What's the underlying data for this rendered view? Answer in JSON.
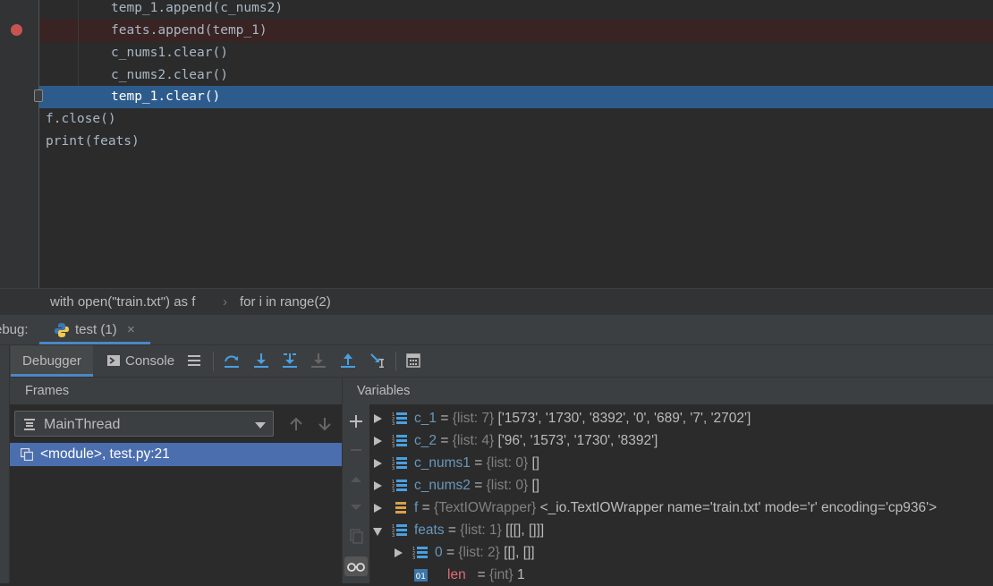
{
  "editor": {
    "lines": [
      {
        "text": "temp_1.append(c_nums2)",
        "indent": 2
      },
      {
        "text": "feats.append(temp_1)",
        "indent": 2,
        "breakpoint": true
      },
      {
        "text": "c_nums1.clear()",
        "indent": 2
      },
      {
        "text": "c_nums2.clear()",
        "indent": 2
      },
      {
        "text": "temp_1.clear()",
        "indent": 2,
        "current": true
      },
      {
        "text": "f.close()",
        "indent": 0
      },
      {
        "text": "print(feats)",
        "indent": 0
      }
    ]
  },
  "breadcrumb": {
    "item1": "with open(\"train.txt\") as f",
    "separator": "›",
    "item2": "for i in range(2)"
  },
  "debug": {
    "label": "ebug:",
    "run_tab": "test (1)",
    "close": "×"
  },
  "toolbar": {
    "debugger": "Debugger",
    "console": "Console"
  },
  "frames": {
    "title": "Frames",
    "thread": "MainThread",
    "frame": "<module>, test.py:21"
  },
  "variables": {
    "title": "Variables",
    "rows": [
      {
        "name": "c_1",
        "type": "{list: 7}",
        "value": "['1573', '1730', '8392', '0', '689', '7', '2702']"
      },
      {
        "name": "c_2",
        "type": "{list: 4}",
        "value": "['96', '1573', '1730', '8392']"
      },
      {
        "name": "c_nums1",
        "type": "{list: 0}",
        "value": "[]"
      },
      {
        "name": "c_nums2",
        "type": "{list: 0}",
        "value": "[]"
      },
      {
        "name": "f",
        "type": "{TextIOWrapper}",
        "value": "<_io.TextIOWrapper name='train.txt' mode='r' encoding='cp936'>"
      },
      {
        "name": "feats",
        "type": "{list: 1}",
        "value": "[[[], []]]"
      },
      {
        "name": "0",
        "type": "{list: 2}",
        "value": "[[], []]"
      },
      {
        "name": "len",
        "type": "{int}",
        "value": "1"
      }
    ]
  },
  "colors": {
    "accent": "#4a88c7",
    "selection": "#2d5c8c",
    "breakpoint": "#c75450",
    "frame_selection": "#4b6eaf"
  }
}
